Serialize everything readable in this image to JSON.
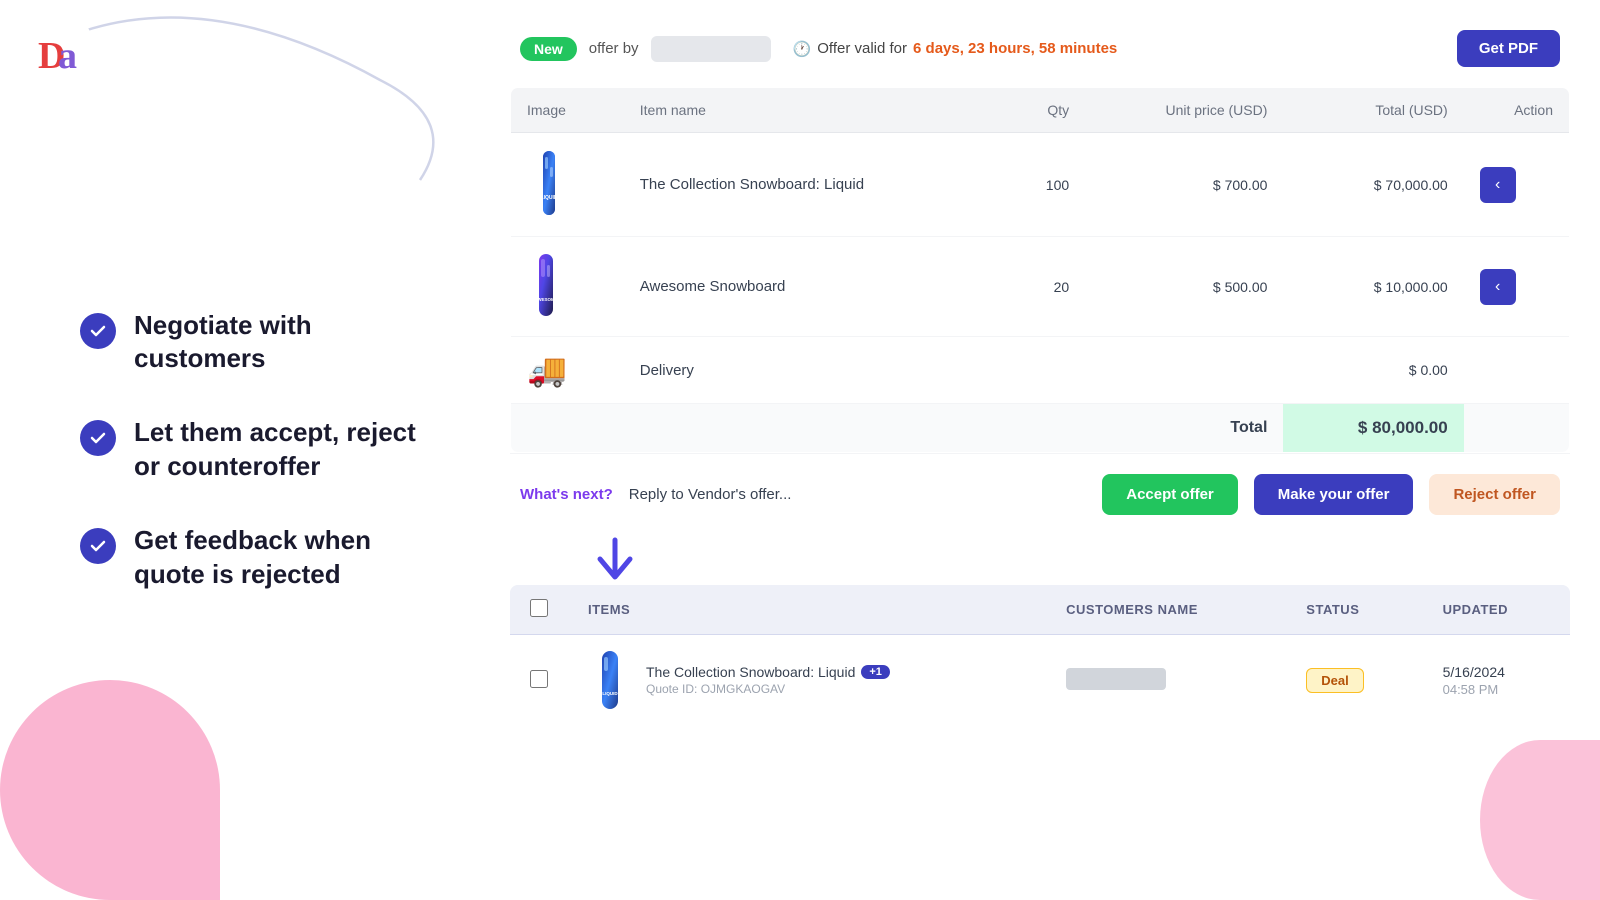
{
  "logo": {
    "alt": "Logo"
  },
  "header": {
    "badge_new": "New",
    "offer_by_label": "offer by",
    "offer_validity_prefix": "Offer valid for",
    "offer_validity_time": "6 days, 23 hours, 58 minutes",
    "get_pdf_label": "Get PDF"
  },
  "table": {
    "columns": [
      "Image",
      "Item name",
      "Qty",
      "Unit price (USD)",
      "Total (USD)",
      "Action"
    ],
    "rows": [
      {
        "item_name": "The Collection Snowboard: Liquid",
        "qty": "100",
        "unit_price": "$ 700.00",
        "total": "$ 70,000.00",
        "type": "snowboard-liquid"
      },
      {
        "item_name": "Awesome Snowboard",
        "qty": "20",
        "unit_price": "$ 500.00",
        "total": "$ 10,000.00",
        "type": "snowboard-awesome"
      },
      {
        "item_name": "Delivery",
        "qty": "",
        "unit_price": "",
        "total": "$ 0.00",
        "type": "delivery"
      }
    ],
    "total_label": "Total",
    "total_value": "$ 80,000.00"
  },
  "reply_section": {
    "whats_next": "What's next?",
    "reply_text": "Reply to Vendor's offer...",
    "accept_offer": "Accept offer",
    "make_offer": "Make your offer",
    "reject_offer": "Reject offer"
  },
  "features": [
    "Negotiate with customers",
    "Let them accept, reject or counteroffer",
    "Get feedback when quote is rejected"
  ],
  "bottom_table": {
    "columns": [
      "",
      "ITEMS",
      "CUSTOMERS NAME",
      "STATUS",
      "UPDATED"
    ],
    "rows": [
      {
        "item_name": "The Collection Snowboard: Liquid",
        "item_badge": "+1",
        "quote_id": "Quote ID: OJMGKAOGAV",
        "customer_name": "",
        "status": "Deal",
        "updated": "5/16/2024",
        "updated_time": "04:58 PM"
      }
    ]
  }
}
